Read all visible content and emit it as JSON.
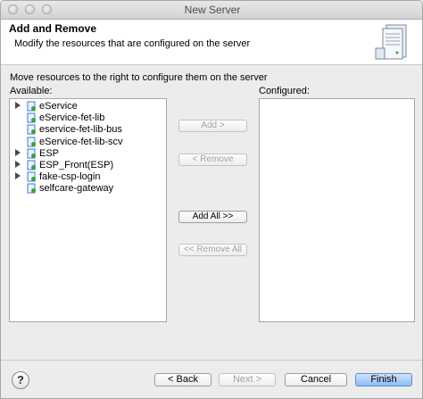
{
  "window": {
    "title": "New Server"
  },
  "header": {
    "title": "Add and Remove",
    "description": "Modify the resources that are configured on the server"
  },
  "instruction": "Move resources to the right to configure them on the server",
  "available": {
    "label": "Available:",
    "items": [
      {
        "label": "eService",
        "expandable": true
      },
      {
        "label": "eService-fet-lib",
        "expandable": false
      },
      {
        "label": "eservice-fet-lib-bus",
        "expandable": false
      },
      {
        "label": "eService-fet-lib-scv",
        "expandable": false
      },
      {
        "label": "ESP",
        "expandable": true
      },
      {
        "label": "ESP_Front(ESP)",
        "expandable": true
      },
      {
        "label": "fake-csp-login",
        "expandable": true
      },
      {
        "label": "selfcare-gateway",
        "expandable": false
      }
    ]
  },
  "configured": {
    "label": "Configured:",
    "items": []
  },
  "buttons": {
    "add": "Add >",
    "remove": "< Remove",
    "add_all": "Add All >>",
    "remove_all": "<< Remove All"
  },
  "footer": {
    "help": "?",
    "back": "< Back",
    "next": "Next >",
    "cancel": "Cancel",
    "finish": "Finish"
  },
  "colors": {
    "finish_button": "#8dbdf1",
    "icon_blue": "#3a7bd5",
    "icon_green": "#3aa13a"
  }
}
